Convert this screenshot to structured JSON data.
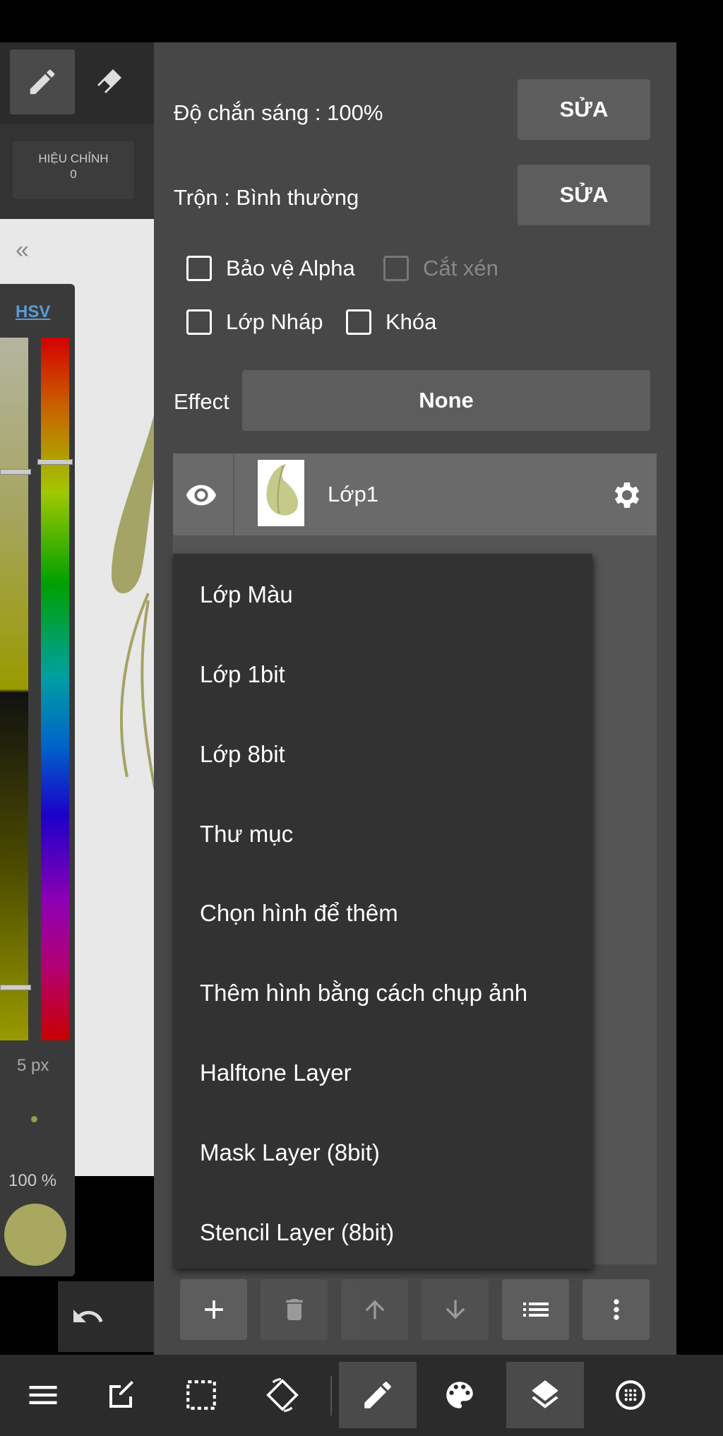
{
  "left_toolbar": {
    "adjust_label": "HIỆU CHỈNH",
    "adjust_value": "0"
  },
  "color_panel": {
    "mode_label": "HSV",
    "brush_size": "5 px",
    "brush_opacity": "100 %",
    "current_color": "#a8a860"
  },
  "layer_panel": {
    "opacity_text": "Độ chắn sáng : 100%",
    "blend_text": "Trộn : Bình thường",
    "edit_label": "SỬA",
    "checkboxes": {
      "alpha": "Bảo vệ Alpha",
      "clip": "Cắt xén",
      "draft": "Lớp Nháp",
      "lock": "Khóa"
    },
    "effect_label": "Effect",
    "effect_value": "None",
    "layers": [
      {
        "name": "Lớp1",
        "visible": true
      }
    ]
  },
  "add_layer_menu": {
    "items": [
      "Lớp Màu",
      "Lớp 1bit",
      "Lớp 8bit",
      "Thư mục",
      "Chọn hình để thêm",
      "Thêm hình bằng cách chụp ảnh",
      "Halftone Layer",
      "Mask Layer (8bit)",
      "Stencil Layer (8bit)"
    ]
  },
  "layer_actions": [
    "add-icon",
    "delete-icon",
    "move-up-icon",
    "move-down-icon",
    "list-icon",
    "more-vertical-icon"
  ],
  "bottom_bar": [
    "menu-icon",
    "edit-icon",
    "selection-icon",
    "rotate-icon",
    "pen-icon",
    "palette-icon",
    "layers-icon",
    "material-icon"
  ],
  "colors": {
    "panel_bg": "#474747",
    "button_bg": "#5d5d5d",
    "menu_bg": "#323232",
    "hsv_link": "#5b9bd5"
  }
}
